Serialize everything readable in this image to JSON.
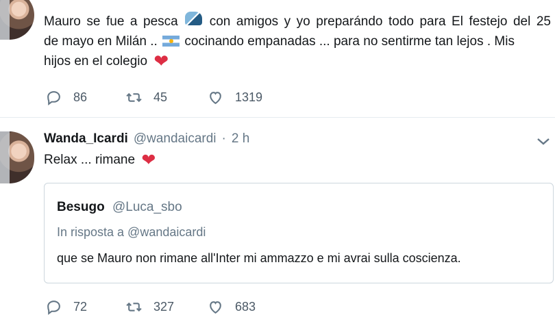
{
  "timeline": {
    "tweet_1": {
      "text_line_1_words": [
        "Mauro",
        "se",
        "fue",
        "a",
        "pesca",
        "🎣",
        "con",
        "amigos",
        "y",
        "yo",
        "preparándo",
        "todo",
        "para",
        "El",
        "festejo",
        "del",
        "25"
      ],
      "text_line_2_a": "de mayo en Milán ..",
      "text_line_2_b": "cocinando empanadas ... para no sentirme tan lejos . Mis",
      "text_line_3": "hijos en el colegio",
      "heart": "❤",
      "emoji_fishing": "fishing-pole-icon",
      "emoji_flag": "argentina-flag-icon",
      "actions": {
        "replies": "86",
        "retweets": "45",
        "likes": "1319"
      }
    },
    "tweet_2": {
      "name": "Wanda_Icardi",
      "handle": "@wandaicardi",
      "separator": "·",
      "time": "2 h",
      "text": "Relax ... rimane",
      "heart": "❤",
      "menu_icon": "chevron-down-icon",
      "quoted": {
        "name": "Besugo",
        "handle": "@Luca_sbo",
        "reply_to": "In risposta a @wandaicardi",
        "text": "que se Mauro non rimane all'Inter mi ammazzo e mi avrai sulla coscienza."
      },
      "actions": {
        "replies": "72",
        "retweets": "327",
        "likes": "683"
      }
    }
  },
  "colors": {
    "text": "#14171a",
    "muted": "#657786",
    "border": "#ccd6dd",
    "heart": "#dd2e44"
  }
}
